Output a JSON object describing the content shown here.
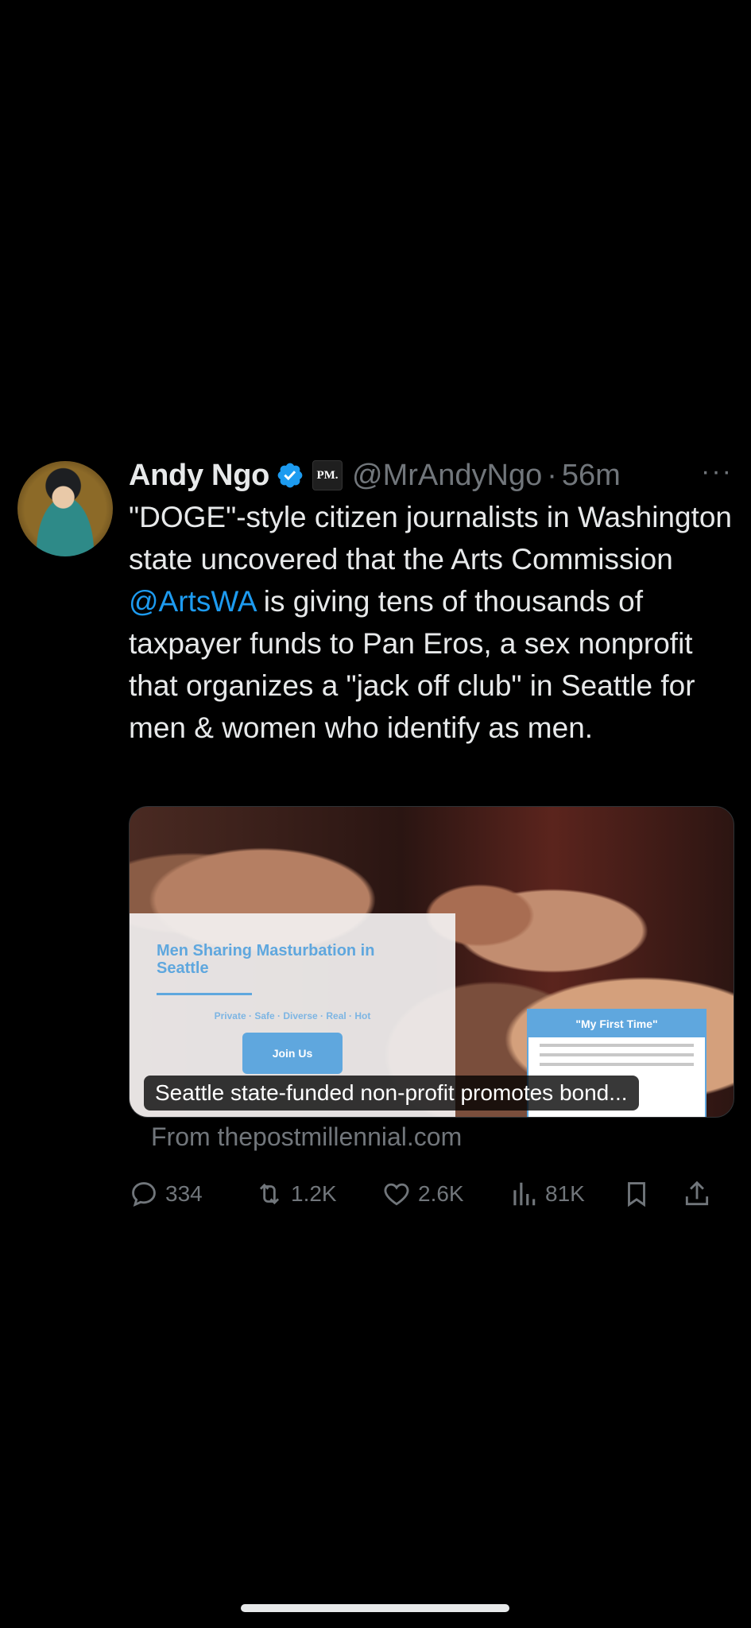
{
  "tweet": {
    "author_name": "Andy Ngo",
    "affiliation_badge": "PM.",
    "handle": "@MrAndyNgo",
    "separator": "·",
    "time": "56m",
    "more": "···",
    "text_part1": "\"DOGE\"-style citizen journalists in Washington state uncovered that the Arts Commission ",
    "mention": "@ArtsWA",
    "text_part2": " is giving tens of thousands of taxpayer funds to Pan Eros, a sex nonprofit that organizes a \"jack off club\" in Seattle for men & women who identify as men."
  },
  "media": {
    "web_title": "Men Sharing Masturbation in Seattle",
    "web_tags": "Private · Safe · Diverse · Real · Hot",
    "web_button": "Join Us",
    "card_title": "\"My First Time\"",
    "link_title": "Seattle state-funded non-profit promotes bond..."
  },
  "source": "From thepostmillennial.com",
  "actions": {
    "replies": "334",
    "reposts": "1.2K",
    "likes": "2.6K",
    "views": "81K"
  },
  "colors": {
    "background": "#000000",
    "text": "#e7e9ea",
    "secondary": "#71767b",
    "accent": "#1d9bf0"
  },
  "icons": [
    "verified-badge-icon",
    "reply-icon",
    "repost-icon",
    "like-icon",
    "views-icon",
    "bookmark-icon",
    "share-icon"
  ]
}
